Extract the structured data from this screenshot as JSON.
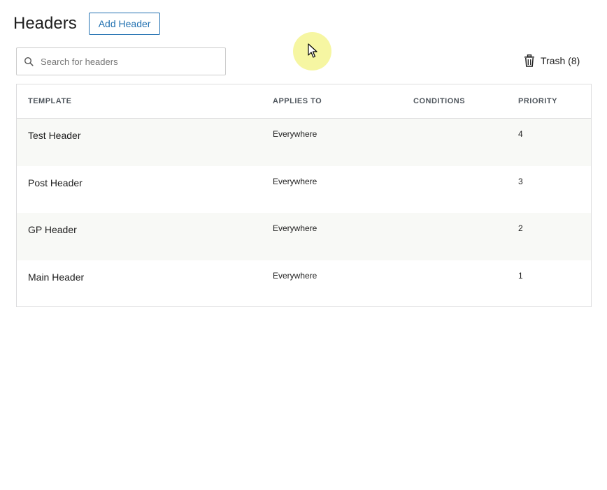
{
  "page": {
    "title": "Headers",
    "add_button_label": "Add Header"
  },
  "search": {
    "placeholder": "Search for headers",
    "value": ""
  },
  "trash": {
    "label": "Trash (8)"
  },
  "table": {
    "columns": [
      "TEMPLATE",
      "APPLIES TO",
      "CONDITIONS",
      "PRIORITY"
    ],
    "rows": [
      {
        "template": "Test Header",
        "applies_to": "Everywhere",
        "conditions": "",
        "priority": "4"
      },
      {
        "template": "Post Header",
        "applies_to": "Everywhere",
        "conditions": "",
        "priority": "3"
      },
      {
        "template": "GP Header",
        "applies_to": "Everywhere",
        "conditions": "",
        "priority": "2"
      },
      {
        "template": "Main Header",
        "applies_to": "Everywhere",
        "conditions": "",
        "priority": "1"
      }
    ]
  },
  "icons": {
    "search": "search-icon",
    "trash": "trash-icon",
    "cursor": "cursor-icon"
  },
  "colors": {
    "accent": "#2271b1",
    "cursor_highlight": "#f0f064"
  }
}
